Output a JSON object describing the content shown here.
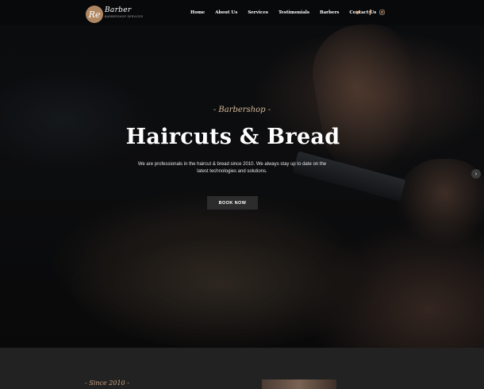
{
  "header": {
    "logo_text": "Re",
    "brand": "Barber",
    "brand_sub": "BARBERSHOP SERVICES",
    "nav": [
      "Home",
      "About Us",
      "Services",
      "Testimonials",
      "Barbers",
      "Contact Us"
    ],
    "social_icons": [
      "twitter-icon",
      "facebook-icon",
      "instagram-icon"
    ]
  },
  "hero": {
    "kicker": "- Barbershop -",
    "title": "Haircuts & Bread",
    "description": "We are professionals in the haircut & bread since 2010. We always stay up to date on the latest technologies and solutions.",
    "cta_label": "BOOK NOW",
    "next_arrow": "›"
  },
  "section2": {
    "kicker": "- Since 2010 -"
  },
  "colors": {
    "accent": "#c9a27f",
    "logo_bg": "#b08763"
  }
}
